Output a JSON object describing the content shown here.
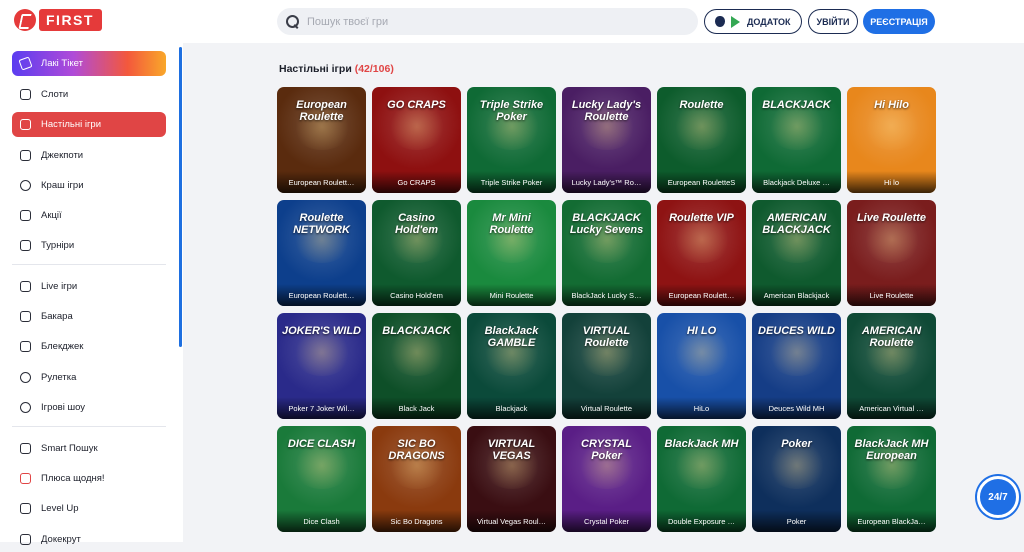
{
  "header": {
    "logo_text": "FIRST",
    "search_placeholder": "Пошук твоєї гри",
    "app_button": "ДОДАТОК",
    "login_button": "УВІЙТИ",
    "register_button": "РЕЄСТРАЦІЯ"
  },
  "sidebar": {
    "items": [
      {
        "label": "Лакі Тікет",
        "icon": "ticket-icon"
      },
      {
        "label": "Слоти",
        "icon": "slots-icon"
      },
      {
        "label": "Настільні ігри",
        "icon": "table-games-icon"
      },
      {
        "label": "Джекпоти",
        "icon": "jackpot-icon"
      },
      {
        "label": "Краш ігри",
        "icon": "crash-icon"
      },
      {
        "label": "Акції",
        "icon": "promo-icon"
      },
      {
        "label": "Турніри",
        "icon": "trophy-icon"
      },
      {
        "label": "Live ігри",
        "icon": "live-icon"
      },
      {
        "label": "Бакара",
        "icon": "baccarat-icon"
      },
      {
        "label": "Блекджек",
        "icon": "blackjack-icon"
      },
      {
        "label": "Рулетка",
        "icon": "roulette-icon"
      },
      {
        "label": "Ігрові шоу",
        "icon": "game-show-icon"
      },
      {
        "label": "Smart Пошук",
        "icon": "smart-search-icon"
      },
      {
        "label": "Плюса щодня!",
        "icon": "plus-icon"
      },
      {
        "label": "Level Up",
        "icon": "level-up-icon"
      },
      {
        "label": "Докекрут",
        "icon": "misc-icon"
      }
    ]
  },
  "main": {
    "section_title": "Настільні ігри",
    "section_count": "(42/106)"
  },
  "games": [
    {
      "name": "European Roulett…",
      "art": "European Roulette",
      "bg": "#5a2b0e"
    },
    {
      "name": "Go CRAPS",
      "art": "GO CRAPS",
      "bg": "#8e1010"
    },
    {
      "name": "Triple Strike Poker",
      "art": "Triple Strike Poker",
      "bg": "#0f6a35"
    },
    {
      "name": "Lucky Lady's™ Ro…",
      "art": "Lucky Lady's Roulette",
      "bg": "#4a1e63"
    },
    {
      "name": "European RouletteS",
      "art": "Roulette",
      "bg": "#0d5c2c"
    },
    {
      "name": "Blackjack Deluxe …",
      "art": "BLACKJACK",
      "bg": "#0f6a35"
    },
    {
      "name": "Hi lo",
      "art": "Hi Hilo",
      "bg": "#e8871c"
    },
    {
      "name": "European Roulett…",
      "art": "Roulette NETWORK",
      "bg": "#0d3f8c"
    },
    {
      "name": "Casino Hold'em",
      "art": "Casino Hold'em",
      "bg": "#0f5a2e"
    },
    {
      "name": "Mini Roulette",
      "art": "Mr Mini Roulette",
      "bg": "#1a8a3e"
    },
    {
      "name": "BlackJack Lucky S…",
      "art": "BLACKJACK Lucky Sevens",
      "bg": "#136c33"
    },
    {
      "name": "European Roulett…",
      "art": "Roulette VIP",
      "bg": "#8e1313"
    },
    {
      "name": "American Blackjack",
      "art": "AMERICAN BLACKJACK",
      "bg": "#0f5a2e"
    },
    {
      "name": "Live Roulette",
      "art": "Live Roulette",
      "bg": "#7a1d1d"
    },
    {
      "name": "Poker 7 Joker Wil…",
      "art": "JOKER'S WILD",
      "bg": "#2a2a8a"
    },
    {
      "name": "Black Jack",
      "art": "BLACKJACK",
      "bg": "#0e4f28"
    },
    {
      "name": "Blackjack",
      "art": "BlackJack GAMBLE",
      "bg": "#0b4a3a"
    },
    {
      "name": "Virtual Roulette",
      "art": "VIRTUAL Roulette",
      "bg": "#13413a"
    },
    {
      "name": "HiLo",
      "art": "HI LO",
      "bg": "#1850a8"
    },
    {
      "name": "Deuces Wild MH",
      "art": "DEUCES WILD",
      "bg": "#153d86"
    },
    {
      "name": "American Virtual …",
      "art": "AMERICAN Roulette",
      "bg": "#0f4a36"
    },
    {
      "name": "Dice Clash",
      "art": "DICE CLASH",
      "bg": "#1a7a3a"
    },
    {
      "name": "Sic Bo Dragons",
      "art": "SIC BO DRAGONS",
      "bg": "#8a3a0e"
    },
    {
      "name": "Virtual Vegas Roul…",
      "art": "VIRTUAL VEGAS",
      "bg": "#3a0e12"
    },
    {
      "name": "Crystal Poker",
      "art": "CRYSTAL Poker",
      "bg": "#5a1e86"
    },
    {
      "name": "Double Exposure …",
      "art": "BlackJack MH",
      "bg": "#0f6a35"
    },
    {
      "name": "Poker",
      "art": "Poker",
      "bg": "#0e2f5c"
    },
    {
      "name": "European BlackJa…",
      "art": "BlackJack MH European",
      "bg": "#0f6a35"
    }
  ],
  "support_label": "24/7"
}
